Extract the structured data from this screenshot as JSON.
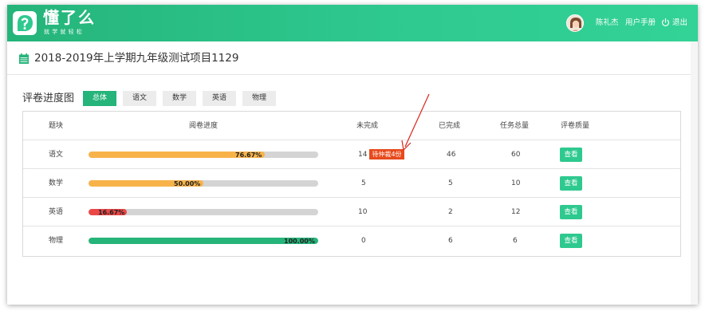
{
  "brand": {
    "title": "懂了么",
    "subtitle": "就学就轻松"
  },
  "header": {
    "user_name": "陈礼杰",
    "manual_label": "用户手册",
    "logout_label": "退出"
  },
  "project": {
    "title": "2018-2019年上学期九年级测试项目1129"
  },
  "section": {
    "title": "评卷进度图"
  },
  "tabs": [
    {
      "label": "总体",
      "active": true
    },
    {
      "label": "语文",
      "active": false
    },
    {
      "label": "数学",
      "active": false
    },
    {
      "label": "英语",
      "active": false
    },
    {
      "label": "物理",
      "active": false
    }
  ],
  "table": {
    "headers": {
      "subject": "题块",
      "progress": "阅卷进度",
      "incomplete": "未完成",
      "completed": "已完成",
      "total": "任务总量",
      "quality": "评卷质量"
    },
    "rows": [
      {
        "subject": "语文",
        "progress_label": "76.67%",
        "progress": 76.67,
        "color": "#f7b34a",
        "incomplete": "14",
        "badge": "待仲裁4份",
        "completed": "46",
        "total": "60",
        "action": "查看"
      },
      {
        "subject": "数学",
        "progress_label": "50.00%",
        "progress": 50.0,
        "color": "#f7b34a",
        "incomplete": "5",
        "completed": "5",
        "total": "10",
        "action": "查看"
      },
      {
        "subject": "英语",
        "progress_label": "16.67%",
        "progress": 16.67,
        "color": "#ec4747",
        "incomplete": "10",
        "completed": "2",
        "total": "12",
        "action": "查看"
      },
      {
        "subject": "物理",
        "progress_label": "100.00%",
        "progress": 100.0,
        "color": "#25b47a",
        "incomplete": "0",
        "completed": "6",
        "total": "6",
        "action": "查看"
      }
    ]
  },
  "colors": {
    "brand": "#25b47a",
    "button": "#2ec98f",
    "badge": "#e74a1c",
    "arrow": "#d9261c"
  }
}
